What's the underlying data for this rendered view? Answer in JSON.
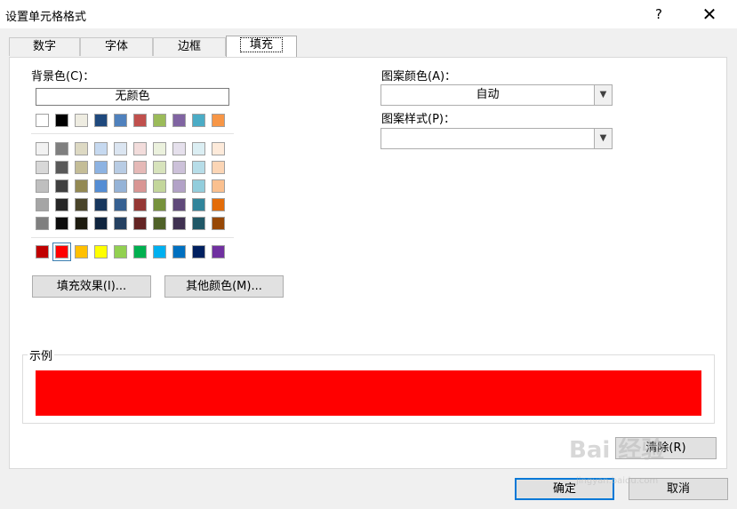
{
  "window": {
    "title": "设置单元格格式",
    "help": "?",
    "close": "✕"
  },
  "tabs": [
    {
      "label": "数字"
    },
    {
      "label": "字体"
    },
    {
      "label": "边框"
    },
    {
      "label": "填充",
      "active": true
    }
  ],
  "fill": {
    "bg_label": "背景色(C)：",
    "no_color": "无颜色",
    "theme_row": [
      "#ffffff",
      "#000000",
      "#eeece1",
      "#1f497d",
      "#4f81bd",
      "#c0504d",
      "#9bbb59",
      "#8064a2",
      "#4bacc6",
      "#f79646"
    ],
    "tint_rows": [
      [
        "#f2f2f2",
        "#7f7f7f",
        "#ddd9c3",
        "#c6d9f0",
        "#dbe5f1",
        "#f2dcdb",
        "#ebf1dd",
        "#e5e0ec",
        "#dbeef3",
        "#fdeada"
      ],
      [
        "#d8d8d8",
        "#595959",
        "#c4bd97",
        "#8db3e2",
        "#b8cce4",
        "#e5b9b7",
        "#d7e3bc",
        "#ccc1d9",
        "#b7dde8",
        "#fbd5b5"
      ],
      [
        "#bfbfbf",
        "#3f3f3f",
        "#938953",
        "#548dd4",
        "#95b3d7",
        "#d99694",
        "#c3d69b",
        "#b2a2c7",
        "#92cddc",
        "#fac08f"
      ],
      [
        "#a5a5a5",
        "#262626",
        "#494429",
        "#17365d",
        "#366092",
        "#953734",
        "#76923c",
        "#5f497a",
        "#31859b",
        "#e36c09"
      ],
      [
        "#7f7f7f",
        "#0c0c0c",
        "#1d1b10",
        "#0f243e",
        "#244061",
        "#632423",
        "#4f6128",
        "#3f3151",
        "#205867",
        "#974806"
      ]
    ],
    "standard_row": [
      "#c00000",
      "#ff0000",
      "#ffc000",
      "#ffff00",
      "#92d050",
      "#00b050",
      "#00b0f0",
      "#0070c0",
      "#002060",
      "#7030a0"
    ],
    "selected_color": "#ff0000",
    "fill_effects_button": "填充效果(I)...",
    "more_colors_button": "其他颜色(M)...",
    "pattern_color_label": "图案颜色(A)：",
    "pattern_color_value": "自动",
    "pattern_style_label": "图案样式(P)：",
    "pattern_style_value": "",
    "sample_label": "示例",
    "sample_color": "#ff0000",
    "clear_button": "清除(R)"
  },
  "footer": {
    "ok": "确定",
    "cancel": "取消"
  },
  "watermark": {
    "big": "Bai 经验",
    "small": "jingyan.baidu.com"
  }
}
